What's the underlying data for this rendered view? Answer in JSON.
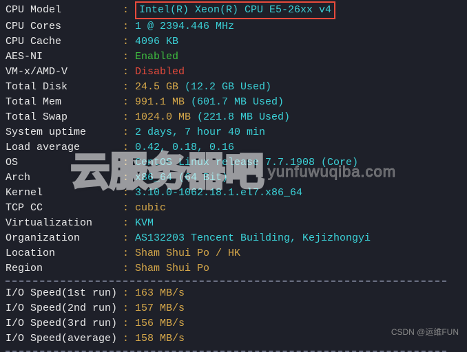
{
  "rows": [
    {
      "label": "CPU Model",
      "value": "Intel(R) Xeon(R) CPU E5-26xx v4",
      "cls": "v-cyan",
      "highlight": true
    },
    {
      "label": "CPU Cores",
      "value": "1 @ 2394.446 MHz",
      "cls": "v-cyan"
    },
    {
      "label": "CPU Cache",
      "value": "4096 KB",
      "cls": "v-cyan"
    },
    {
      "label": "AES-NI",
      "value": "Enabled",
      "cls": "v-green"
    },
    {
      "label": "VM-x/AMD-V",
      "value": "Disabled",
      "cls": "v-red"
    },
    {
      "label": "Total Disk",
      "value": "24.5 GB",
      "extra": "(12.2 GB Used)",
      "cls": "v-yellow"
    },
    {
      "label": "Total Mem",
      "value": "991.1 MB",
      "extra": "(601.7 MB Used)",
      "cls": "v-yellow"
    },
    {
      "label": "Total Swap",
      "value": "1024.0 MB",
      "extra": "(221.8 MB Used)",
      "cls": "v-yellow"
    },
    {
      "label": "System uptime",
      "value": "2 days, 7 hour 40 min",
      "cls": "v-cyan"
    },
    {
      "label": "Load average",
      "value": "0.42, 0.18, 0.16",
      "cls": "v-cyan"
    },
    {
      "label": "OS",
      "value": "CentOS Linux release 7.7.1908 (Core)",
      "cls": "v-cyan"
    },
    {
      "label": "Arch",
      "value": "x86_64 (64 Bit)",
      "cls": "v-cyan"
    },
    {
      "label": "Kernel",
      "value": "3.10.0-1062.18.1.el7.x86_64",
      "cls": "v-cyan"
    },
    {
      "label": "TCP CC",
      "value": "cubic",
      "cls": "v-yellow"
    },
    {
      "label": "Virtualization",
      "value": "KVM",
      "cls": "v-cyan"
    },
    {
      "label": "Organization",
      "value": "AS132203 Tencent Building, Kejizhongyi",
      "cls": "v-cyan"
    },
    {
      "label": "Location",
      "value": "Sham Shui Po / HK",
      "cls": "v-yellow"
    },
    {
      "label": "Region",
      "value": "Sham Shui Po",
      "cls": "v-yellow"
    }
  ],
  "io": [
    {
      "label": "I/O Speed(1st run)",
      "value": "163 MB/s"
    },
    {
      "label": "I/O Speed(2nd run)",
      "value": "157 MB/s"
    },
    {
      "label": "I/O Speed(3rd run)",
      "value": "156 MB/s"
    },
    {
      "label": "I/O Speed(average)",
      "value": "158 MB/s"
    }
  ],
  "watermark": {
    "cn": "云服务器吧",
    "en": "yunfuwuqiba.com"
  },
  "credit": "CSDN @运维FUN"
}
